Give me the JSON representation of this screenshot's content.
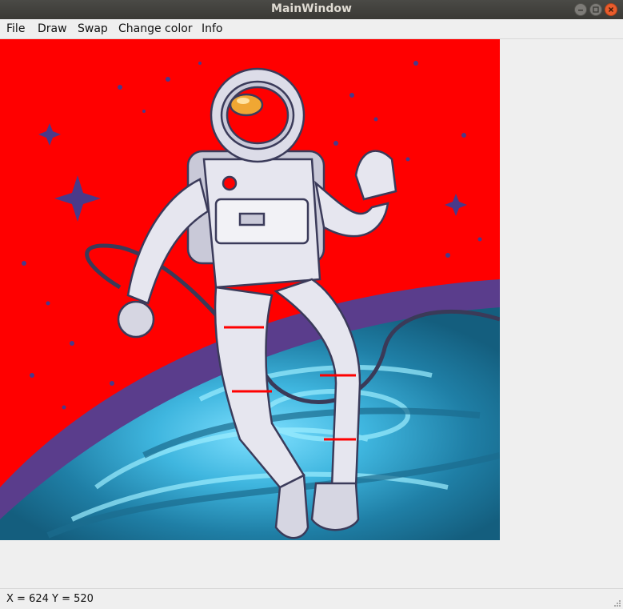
{
  "window": {
    "title": "MainWindow"
  },
  "menu": {
    "file": "File",
    "draw": "Draw",
    "swap": "Swap",
    "change_color": "Change color",
    "info": "Info"
  },
  "image": {
    "subject": "astronaut floating in space",
    "background_color": "#ff0000"
  },
  "status": {
    "text": "X = 624 Y = 520"
  }
}
